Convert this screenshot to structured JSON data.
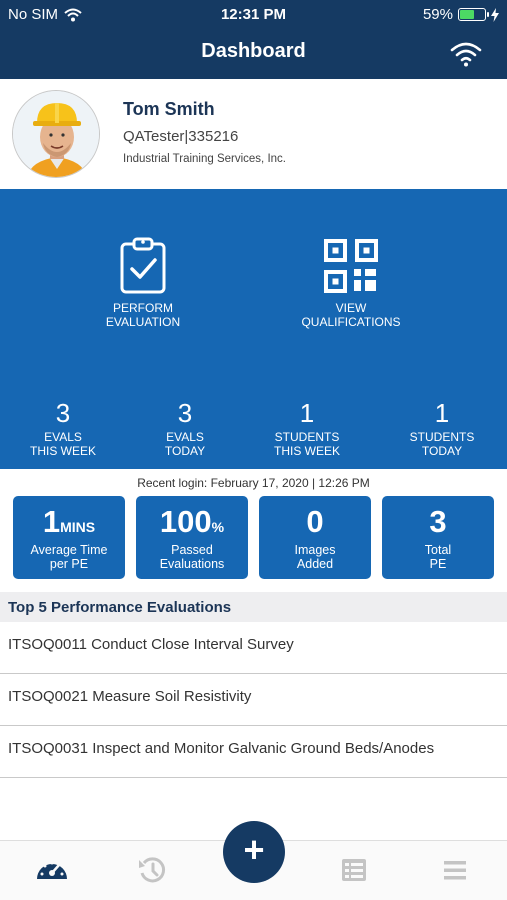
{
  "status_bar": {
    "carrier": "No SIM",
    "time": "12:31 PM",
    "battery": "59%",
    "battery_level": 0.59
  },
  "nav": {
    "title": "Dashboard",
    "right_icon": "wifi-icon"
  },
  "profile": {
    "name": "Tom Smith",
    "role": "QATester|335216",
    "company": "Industrial Training Services, Inc."
  },
  "actions": [
    {
      "label_line1": "PERFORM",
      "label_line2": "EVALUATION",
      "icon": "clipboard-check-icon"
    },
    {
      "label_line1": "VIEW",
      "label_line2": "QUALIFICATIONS",
      "icon": "qr-code-icon"
    }
  ],
  "stats": [
    {
      "value": "3",
      "line1": "EVALS",
      "line2": "THIS WEEK"
    },
    {
      "value": "3",
      "line1": "EVALS",
      "line2": "TODAY"
    },
    {
      "value": "1",
      "line1": "STUDENTS",
      "line2": "THIS WEEK"
    },
    {
      "value": "1",
      "line1": "STUDENTS",
      "line2": "TODAY"
    }
  ],
  "recent_login": "Recent login: February 17, 2020 | 12:26 PM",
  "cards": [
    {
      "value": "1",
      "unit": "MINS",
      "line1": "Average Time",
      "line2": "per PE"
    },
    {
      "value": "100",
      "unit": "%",
      "line1": "Passed",
      "line2": "Evaluations"
    },
    {
      "value": "0",
      "unit": "",
      "line1": "Images",
      "line2": "Added"
    },
    {
      "value": "3",
      "unit": "",
      "line1": "Total",
      "line2": "PE"
    }
  ],
  "section_title": "Top 5 Performance Evaluations",
  "evaluations": [
    "ITSOQ0011 Conduct Close Interval Survey",
    "ITSOQ0021 Measure Soil Resistivity",
    "ITSOQ0031 Inspect and Monitor Galvanic Ground Beds/Anodes"
  ],
  "tabs": [
    {
      "icon": "dashboard-gauge-icon",
      "active": true
    },
    {
      "icon": "history-icon",
      "active": false
    },
    {
      "icon": "list-icon",
      "active": false
    },
    {
      "icon": "menu-icon",
      "active": false
    }
  ],
  "fab": {
    "label": "+"
  },
  "colors": {
    "navy": "#153a63",
    "blue": "#1667b3",
    "inactive_tab": "#c4c4c4"
  }
}
